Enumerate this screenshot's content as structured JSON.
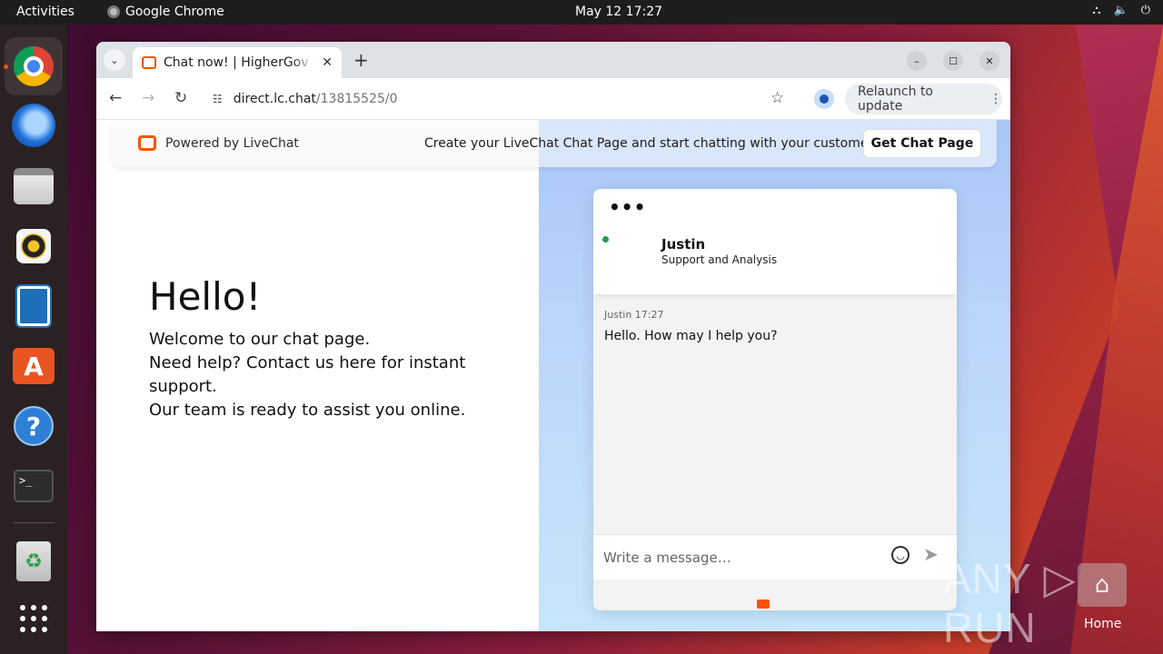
{
  "topbar": {
    "activities": "Activities",
    "app_name": "Google Chrome",
    "clock": "May 12  17:27",
    "tray_icons": [
      "network-icon",
      "volume-icon",
      "power-icon"
    ]
  },
  "dock": {
    "items": [
      "chrome-icon",
      "thunderbird-icon",
      "files-icon",
      "rhythmbox-icon",
      "libreoffice-writer-icon",
      "app-center-icon",
      "help-icon",
      "terminal-icon",
      "trash-icon",
      "show-apps-icon"
    ],
    "help_glyph": "?",
    "terminal_glyph": ">_"
  },
  "browser": {
    "tab_title": "Chat now! | HigherGov Chat",
    "url_host": "direct.lc.chat",
    "url_path": "/13815525/0",
    "relaunch_label": "Relaunch to update"
  },
  "banner": {
    "powered": "Powered by LiveChat",
    "cta_text": "Create your LiveChat Chat Page and start chatting with your customers.",
    "cta_button": "Get Chat Page"
  },
  "page": {
    "heading": "Hello!",
    "lines": [
      "Welcome to our chat page.",
      "Need help? Contact us here for instant support.",
      "Our team is ready to assist you online."
    ]
  },
  "chat": {
    "agent_name": "Justin",
    "agent_role": "Support and Analysis",
    "message_meta": "Justin 17:27",
    "message_text": "Hello. How may I help you?",
    "input_placeholder": "Write a message…"
  },
  "desktop": {
    "watermark": "ANY ▷ RUN",
    "home_label": "Home"
  }
}
